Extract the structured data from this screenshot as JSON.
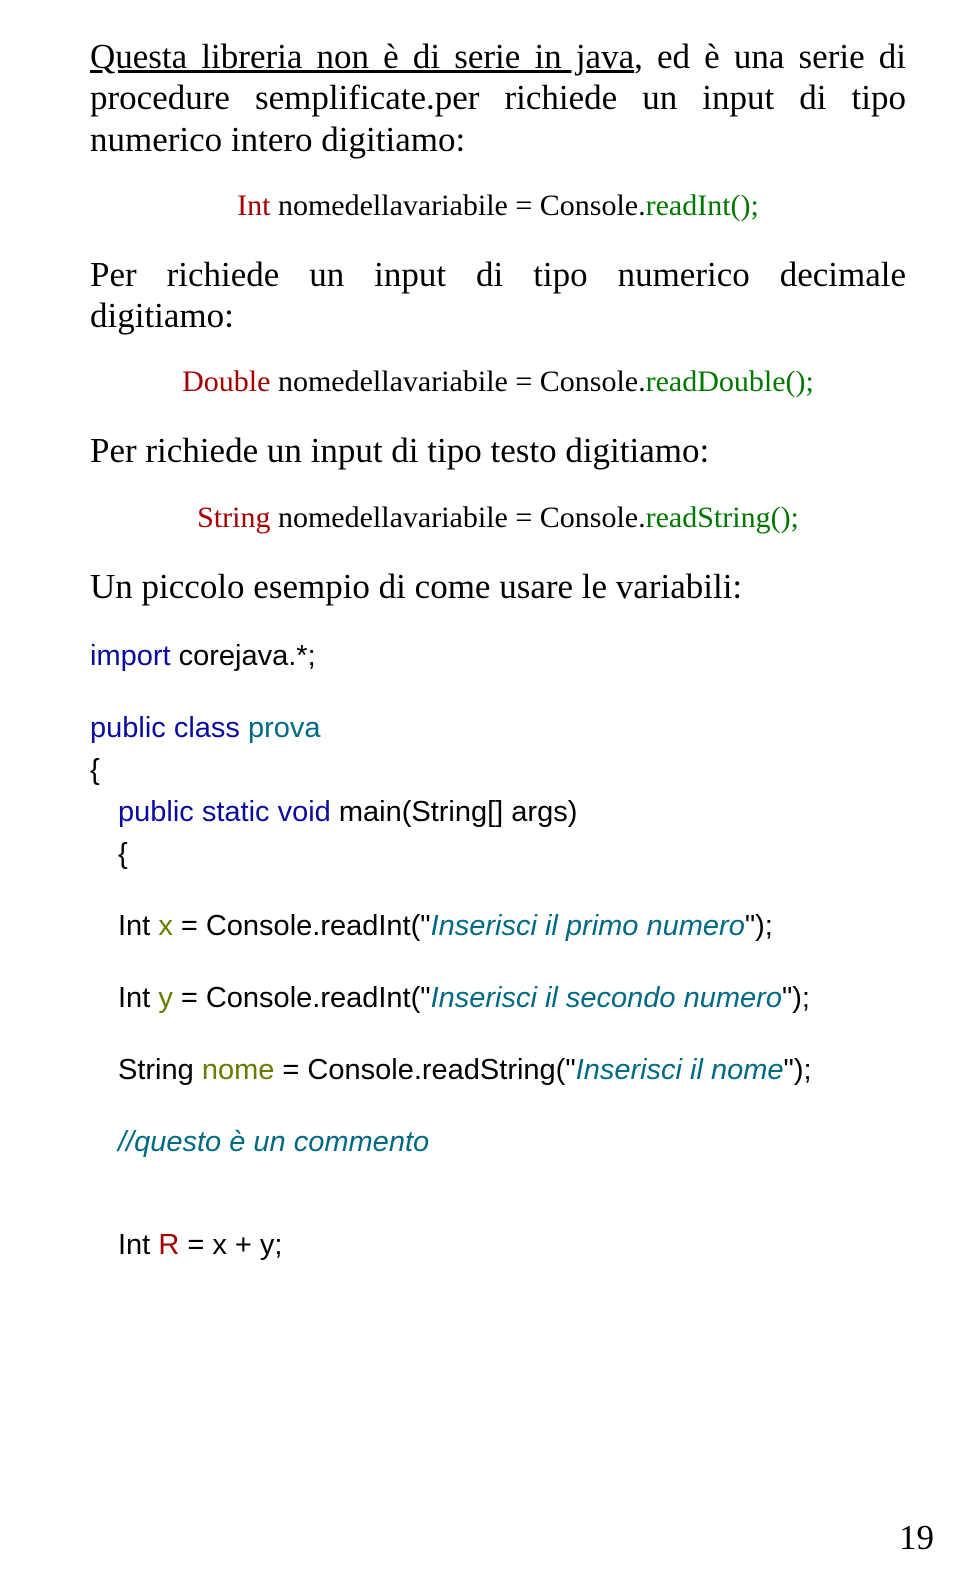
{
  "colors": {
    "red": "#a50000",
    "green": "#007800",
    "blue": "#0b0ba0",
    "teal": "#006a84",
    "olive": "#6a7a00",
    "black": "#000000"
  },
  "p1_a": "Questa libreria non è di serie in java",
  "p1_b": ", ed è una serie di procedure semplificate.per richiede un input di tipo numerico intero digitiamo:",
  "c1_a": "Int",
  "c1_b": " nomedellavariabile = Console.",
  "c1_c": "readInt();",
  "p2": "Per richiede un input di tipo numerico decimale digitiamo:",
  "c2_a": "Double",
  "c2_b": " nomedellavariabile = Console.",
  "c2_c": "readDouble();",
  "p3": "Per richiede un input di tipo testo digitiamo:",
  "c3_a": "String",
  "c3_b": " nomedellavariabile = Console.",
  "c3_c": "readString();",
  "p4": "Un piccolo esempio di come usare le variabili:",
  "code": {
    "l1_a": "import",
    "l1_b": " corejava.*;",
    "l2_a": "public",
    "l2_b": " ",
    "l2_c": "class",
    "l2_d": " ",
    "l2_e": "prova",
    "l3": "{",
    "l4_a": "public",
    "l4_b": " ",
    "l4_c": "static",
    "l4_d": " ",
    "l4_e": "void",
    "l4_f": " main(String[] args)",
    "l5": "{",
    "l6_a": "Int ",
    "l6_b": "x",
    "l6_c": " = Console.readInt(\"",
    "l6_d": "Inserisci il primo numero",
    "l6_e": "\");",
    "l7_a": "Int ",
    "l7_b": "y",
    "l7_c": " = Console.readInt(\"",
    "l7_d": "Inserisci il secondo numero",
    "l7_e": "\");",
    "l8_a": "String ",
    "l8_b": "nome",
    "l8_c": " = Console.readString(\"",
    "l8_d": "Inserisci il nome",
    "l8_e": "\");",
    "l9": "//questo è un commento",
    "l10_a": "Int ",
    "l10_b": "R",
    "l10_c": " = x + y;"
  },
  "pagenum": "19"
}
